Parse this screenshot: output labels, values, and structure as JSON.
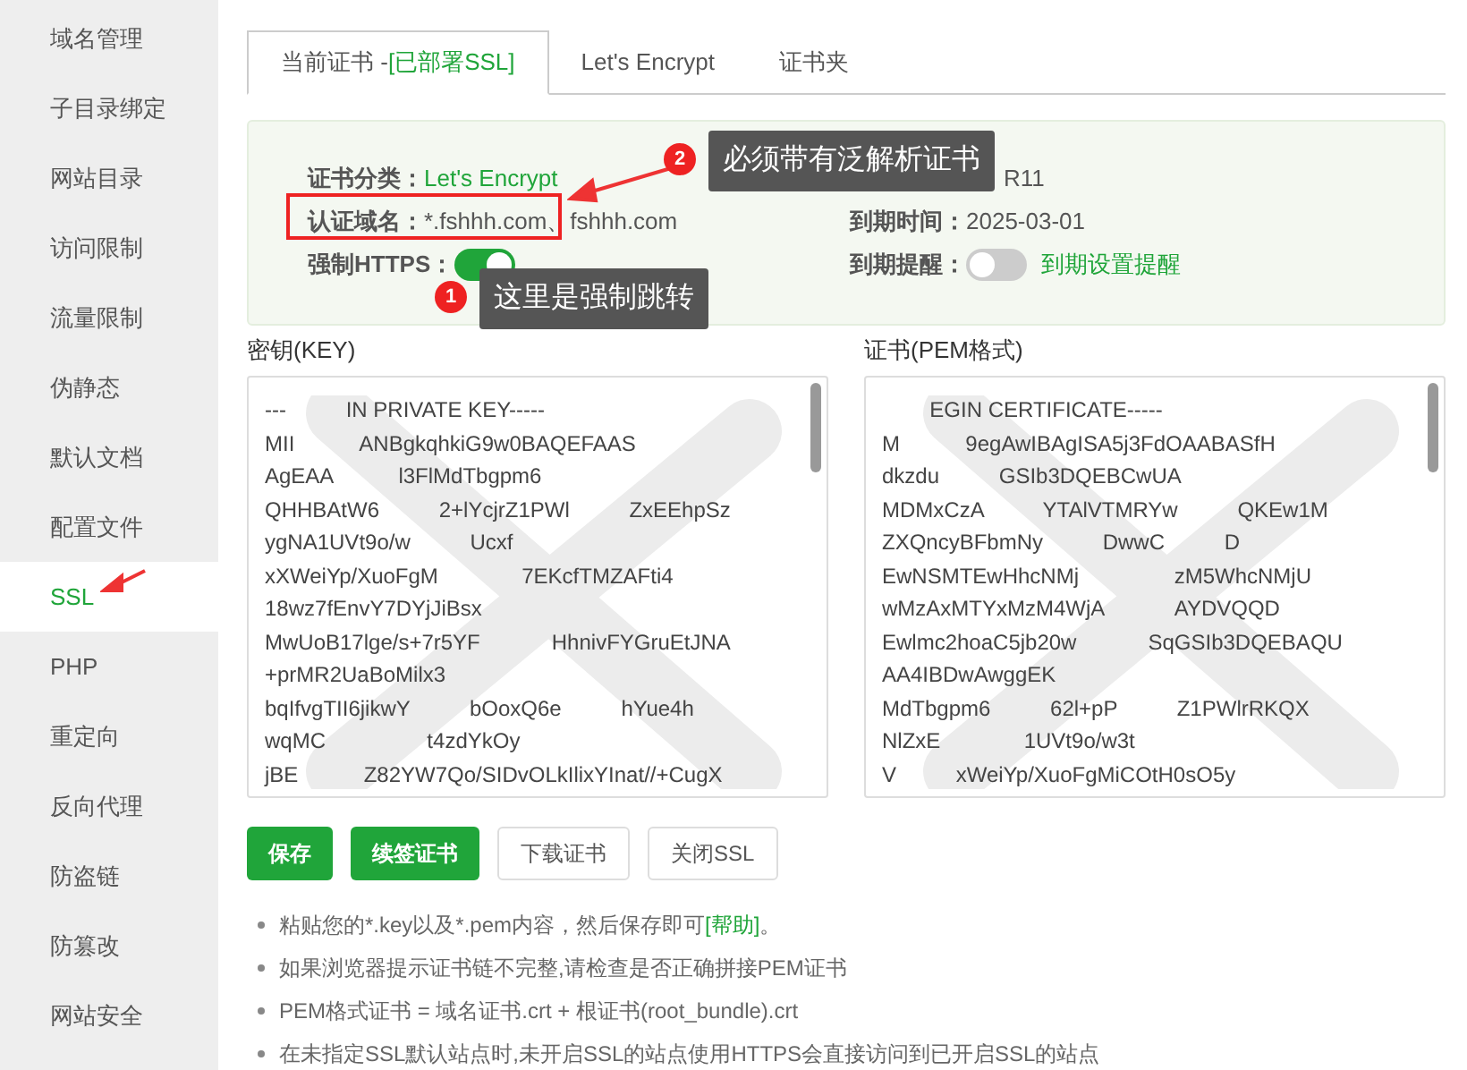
{
  "sidebar": {
    "items": [
      {
        "label": "域名管理",
        "selected": false
      },
      {
        "label": "子目录绑定",
        "selected": false
      },
      {
        "label": "网站目录",
        "selected": false
      },
      {
        "label": "访问限制",
        "selected": false
      },
      {
        "label": "流量限制",
        "selected": false
      },
      {
        "label": "伪静态",
        "selected": false
      },
      {
        "label": "默认文档",
        "selected": false
      },
      {
        "label": "配置文件",
        "selected": false
      },
      {
        "label": "SSL",
        "selected": true
      },
      {
        "label": "PHP",
        "selected": false
      },
      {
        "label": "重定向",
        "selected": false
      },
      {
        "label": "反向代理",
        "selected": false
      },
      {
        "label": "防盗链",
        "selected": false
      },
      {
        "label": "防篡改",
        "selected": false
      },
      {
        "label": "网站安全",
        "selected": false
      }
    ]
  },
  "tabs": [
    {
      "label": "当前证书 -",
      "badge": "[已部署SSL]",
      "selected": true
    },
    {
      "label": "Let's Encrypt",
      "selected": false
    },
    {
      "label": "证书夹",
      "selected": false
    }
  ],
  "info": {
    "left": [
      {
        "kind": "text",
        "label": "证书分类：",
        "value": "Let's Encrypt",
        "highlight": true
      },
      {
        "kind": "text",
        "label": "认证域名：",
        "value": "*.fshhh.com、fshhh.com",
        "highlight": false
      },
      {
        "kind": "toggle",
        "label": "强制HTTPS：",
        "on": true
      }
    ],
    "right": [
      {
        "kind": "text",
        "value": "R11",
        "highlight": false
      },
      {
        "kind": "text",
        "label": "到期时间：",
        "value": "2025-03-01",
        "highlight": false
      },
      {
        "kind": "toggle",
        "label": "到期提醒：",
        "on": false,
        "link": "到期设置提醒"
      }
    ]
  },
  "key": {
    "label": "密钥(KEY)",
    "lines": [
      "---          IN PRIVATE KEY-----",
      "MII           ANBgkqhkiG9w0BAQEFAAS",
      "AgEAA           l3FlMdTbgpm6",
      "QHHBAtW6          2+lYcjrZ1PWl          ZxEEhpSz",
      "ygNA1UVt9o/w          Ucxf",
      "xXWeiYp/XuoFgM              7EKcfTMZAFti4",
      "18wz7fEnvY7DYjJiBsx",
      "MwUoB17lge/s+7r5YF            HhnivFYGruEtJNA",
      "+prMR2UaBoMilx3",
      "bqIfvgTII6jikwY          bOoxQ6e          hYue4h",
      "wqMC                 t4zdYkOy",
      "jBE           Z82YW7Qo/SIDvOLkIlixYInat//+CugX"
    ]
  },
  "cert": {
    "label": "证书(PEM格式)",
    "lines": [
      "        EGIN CERTIFICATE-----",
      "M           9egAwIBAgISA5j3FdOAABASfH",
      "dkzdu          GSIb3DQEBCwUA",
      "MDMxCzA          YTAlVTMRYw          QKEw1M",
      "ZXQncyBFbmNy          DwwC          D",
      "EwNSMTEwHhcNMj                zM5WhcNMjU",
      "wMzAxMTYxMzM4WjA            AYDVQQD",
      "Ewlmc2hoaC5jb20w            SqGSIb3DQEBAQU",
      "AA4IBDwAwggEK",
      "MdTbgpm6          62l+pP          Z1PWlrRKQX",
      "NlZxE              1UVt9o/w3t",
      "V          xWeiYp/XuoFgMiCOtH0sO5y"
    ]
  },
  "buttons": [
    {
      "label": "保存",
      "kind": "primary"
    },
    {
      "label": "续签证书",
      "kind": "primary"
    },
    {
      "label": "下载证书",
      "kind": "default"
    },
    {
      "label": "关闭SSL",
      "kind": "default"
    }
  ],
  "notes": [
    {
      "text": "粘贴您的*.key以及*.pem内容，然后保存即可",
      "link": "[帮助]",
      "after": "。"
    },
    {
      "text": "如果浏览器提示证书链不完整,请检查是否正确拼接PEM证书"
    },
    {
      "text": "PEM格式证书 = 域名证书.crt + 根证书(root_bundle).crt"
    },
    {
      "text": "在未指定SSL默认站点时,未开启SSL的站点使用HTTPS会直接访问到已开启SSL的站点"
    }
  ],
  "callouts": [
    {
      "number": "2",
      "text": "必须带有泛解析证书"
    },
    {
      "number": "1",
      "text": "这里是强制跳转"
    }
  ]
}
